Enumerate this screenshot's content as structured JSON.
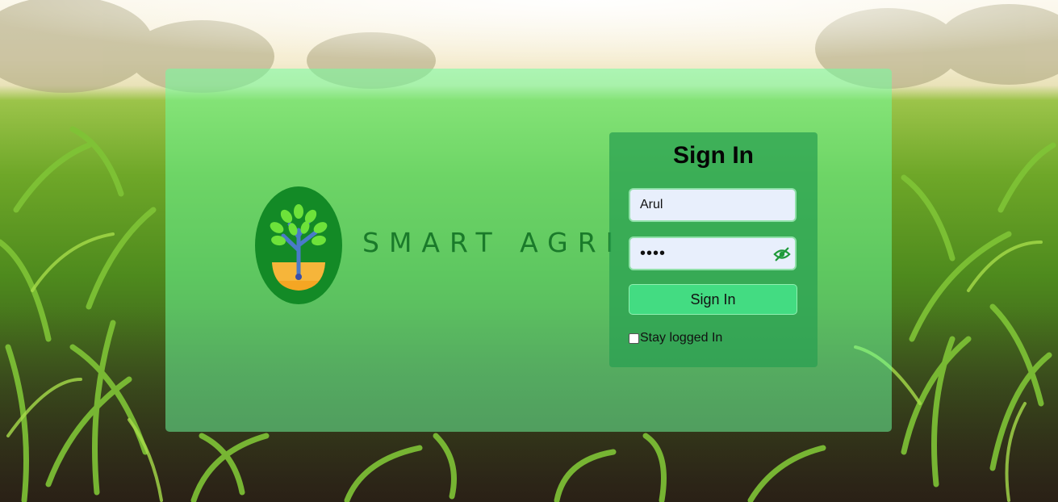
{
  "brand": {
    "name": "SMART AGRI",
    "logo_icon": "tree-in-shield-logo"
  },
  "signin": {
    "title": "Sign In",
    "username_value": "Arul",
    "password_masked": "••••",
    "toggle_icon": "eye-slash-icon",
    "submit_label": "Sign In",
    "stay_logged_label": "Stay logged In",
    "stay_logged_checked": false
  },
  "colors": {
    "card": "#6effa0",
    "panel": "#28a050",
    "button": "#43dc82",
    "brand_text": "#1a7a2a",
    "input_bg": "#e8effc"
  }
}
